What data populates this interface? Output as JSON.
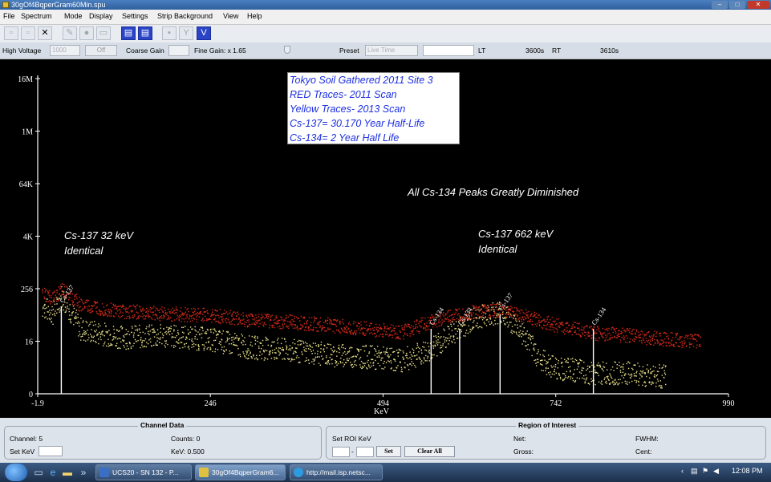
{
  "window": {
    "title": "30gOf4BqperGram60Min.spu",
    "min_label": "–",
    "max_label": "□",
    "close_label": "✕"
  },
  "menu": {
    "items": [
      "File",
      "Spectrum",
      "Mode",
      "Display",
      "Settings",
      "Strip Background",
      "View",
      "Help"
    ]
  },
  "toolbar": {
    "icons": [
      "new-icon",
      "open-icon",
      "close-x-icon",
      "edit-icon",
      "circle-icon",
      "export-icon",
      "document-icon",
      "document-copy-icon",
      "lock-icon",
      "filter-icon",
      "marker-icon"
    ],
    "close_glyph": "✕",
    "marker_glyph": "V"
  },
  "controls": {
    "high_voltage_label": "High Voltage",
    "high_voltage_value": "1000",
    "off_label": "Off",
    "coarse_gain_label": "Coarse Gain",
    "fine_gain_label": "Fine Gain: x 1.65",
    "preset_label": "Preset",
    "preset_value": "Live Time",
    "lt_label": "LT",
    "lt_value": "3600s",
    "rt_label": "RT",
    "rt_value": "3610s"
  },
  "chart_data": {
    "type": "scatter",
    "xlabel": "KeV",
    "x_ticks": [
      "-1.9",
      "246",
      "494",
      "742",
      "990"
    ],
    "y_ticks": [
      "16M",
      "1M",
      "64K",
      "4K",
      "256",
      "16",
      "0"
    ],
    "xlim": [
      -1.9,
      990
    ],
    "y_scale": "log",
    "series": [
      {
        "name": "RED Traces- 2011 Scan",
        "color": "#d42a1a",
        "points": [
          [
            5,
            200
          ],
          [
            20,
            150
          ],
          [
            32,
            250
          ],
          [
            60,
            110
          ],
          [
            120,
            80
          ],
          [
            180,
            70
          ],
          [
            246,
            65
          ],
          [
            300,
            50
          ],
          [
            360,
            45
          ],
          [
            420,
            38
          ],
          [
            480,
            30
          ],
          [
            520,
            26
          ],
          [
            560,
            45
          ],
          [
            600,
            65
          ],
          [
            625,
            75
          ],
          [
            662,
            85
          ],
          [
            700,
            60
          ],
          [
            742,
            38
          ],
          [
            800,
            25
          ],
          [
            850,
            22
          ],
          [
            900,
            18
          ],
          [
            950,
            16
          ]
        ]
      },
      {
        "name": "Yellow Traces- 2013 Scan",
        "color": "#e8e08a",
        "points": [
          [
            5,
            100
          ],
          [
            20,
            70
          ],
          [
            32,
            180
          ],
          [
            60,
            30
          ],
          [
            120,
            20
          ],
          [
            180,
            22
          ],
          [
            246,
            18
          ],
          [
            300,
            12
          ],
          [
            360,
            10
          ],
          [
            420,
            8
          ],
          [
            480,
            7
          ],
          [
            520,
            6
          ],
          [
            560,
            10
          ],
          [
            600,
            30
          ],
          [
            625,
            55
          ],
          [
            662,
            80
          ],
          [
            690,
            30
          ],
          [
            720,
            6
          ],
          [
            742,
            4
          ],
          [
            800,
            3
          ],
          [
            850,
            3
          ],
          [
            900,
            2.5
          ]
        ]
      }
    ],
    "markers": [
      {
        "label": "Cs-137",
        "x": 32
      },
      {
        "label": "Cs-134",
        "x": 563
      },
      {
        "label": "Cs-134",
        "x": 604
      },
      {
        "label": "Cs-137",
        "x": 662
      },
      {
        "label": "Cs-134",
        "x": 796
      }
    ],
    "legend_text": [
      "Tokyo Soil Gathered 2011 Site 3",
      "RED Traces- 2011 Scan",
      "Yellow Traces- 2013 Scan",
      "Cs-137= 30.170 Year Half-Life",
      "Cs-134= 2 Year Half Life"
    ],
    "annotations": [
      {
        "id": "cs137_32",
        "lines": [
          "Cs-137 32 keV",
          "Identical"
        ]
      },
      {
        "id": "cs137_662",
        "lines": [
          "Cs-137 662 keV",
          "Identical"
        ]
      },
      {
        "id": "cs134_note",
        "lines": [
          "All Cs-134 Peaks Greatly Diminished"
        ]
      }
    ]
  },
  "channel_data": {
    "title": "Channel Data",
    "channel_label": "Channel: 5",
    "counts_label": "Counts: 0",
    "set_kev_label": "Set KeV",
    "kev_label": "KeV: 0.500"
  },
  "roi": {
    "title": "Region of Interest",
    "set_roi_label": "Set ROI KeV",
    "dash": "-",
    "set_button": "Set",
    "clear_all_button": "Clear All",
    "net_label": "Net:",
    "gross_label": "Gross:",
    "fwhm_label": "FWHM:",
    "cent_label": "Cent:"
  },
  "taskbar": {
    "tasks": [
      "UCS20 - SN 132 - P...",
      "30gOf4BqperGram6...",
      "http://mail.isp.netsc..."
    ],
    "clock": "12:08 PM",
    "quick_icons": [
      "desktop-icon",
      "ie-icon",
      "folder-icon",
      "arrow-icon"
    ]
  }
}
